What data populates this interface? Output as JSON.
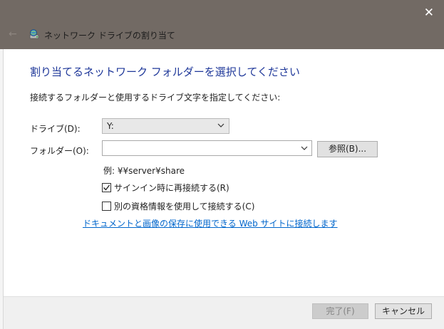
{
  "window": {
    "title": "ネットワーク ドライブの割り当て",
    "close_glyph": "✕",
    "back_glyph": "←"
  },
  "content": {
    "header": "割り当てるネットワーク フォルダーを選択してください",
    "instruction": "接続するフォルダーと使用するドライブ文字を指定してください:",
    "drive_label": "ドライブ(D):",
    "drive_value": "Y:",
    "folder_label": "フォルダー(O):",
    "folder_value": "",
    "browse_label": "参照(B)...",
    "example": "例: ¥¥server¥share",
    "reconnect_label": "サインイン時に再接続する(R)",
    "reconnect_checked": true,
    "credentials_label": "別の資格情報を使用して接続する(C)",
    "credentials_checked": false,
    "link": "ドキュメントと画像の保存に使用できる Web サイトに接続します"
  },
  "footer": {
    "finish_label": "完了(F)",
    "cancel_label": "キャンセル"
  },
  "colors": {
    "titlebar": "#726a64",
    "header_text": "#1e3799",
    "link": "#0066cc"
  }
}
